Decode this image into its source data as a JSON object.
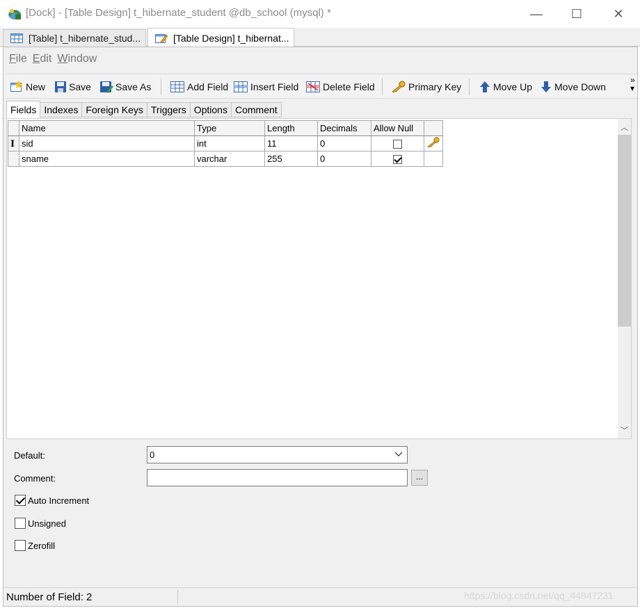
{
  "window": {
    "title": "[Dock] - [Table Design] t_hibernate_student @db_school (mysql) *",
    "minimize": "—",
    "maximize": "☐",
    "close": "✕"
  },
  "doc_tabs": [
    {
      "label": "[Table] t_hibernate_stud...",
      "icon": "table-icon"
    },
    {
      "label": "[Table Design] t_hibernat...",
      "icon": "table-design-icon"
    }
  ],
  "menu": {
    "file": {
      "u": "F",
      "rest": "ile"
    },
    "edit": {
      "u": "E",
      "rest": "dit"
    },
    "window": {
      "u": "W",
      "rest": "indow"
    }
  },
  "toolbar": {
    "new": "New",
    "save": "Save",
    "save_as": "Save As",
    "add_field": "Add Field",
    "insert_field": "Insert Field",
    "delete_field": "Delete Field",
    "primary_key": "Primary Key",
    "move_up": "Move Up",
    "move_down": "Move Down",
    "more": "»"
  },
  "tabs": [
    "Fields",
    "Indexes",
    "Foreign Keys",
    "Triggers",
    "Options",
    "Comment"
  ],
  "grid": {
    "headers": [
      "Name",
      "Type",
      "Length",
      "Decimals",
      "Allow Null"
    ],
    "rows": [
      {
        "name": "sid",
        "type": "int",
        "length": "11",
        "decimals": "0",
        "allow_null": false,
        "primary_key": true
      },
      {
        "name": "sname",
        "type": "varchar",
        "length": "255",
        "decimals": "0",
        "allow_null": true,
        "primary_key": false
      }
    ],
    "row_cursor": "I"
  },
  "properties": {
    "default_label": "Default:",
    "default_value": "0",
    "comment_label": "Comment:",
    "comment_value": "",
    "ellipsis": "...",
    "auto_increment_label": "Auto Increment",
    "auto_increment": true,
    "unsigned_label": "Unsigned",
    "unsigned": false,
    "zerofill_label": "Zerofill",
    "zerofill": false
  },
  "status": {
    "text": "Number of Field: 2"
  },
  "watermark": "https://blog.csdn.net/qq_44847231",
  "colors": {
    "accent": "#3c7bd6",
    "key": "#e8a317"
  }
}
